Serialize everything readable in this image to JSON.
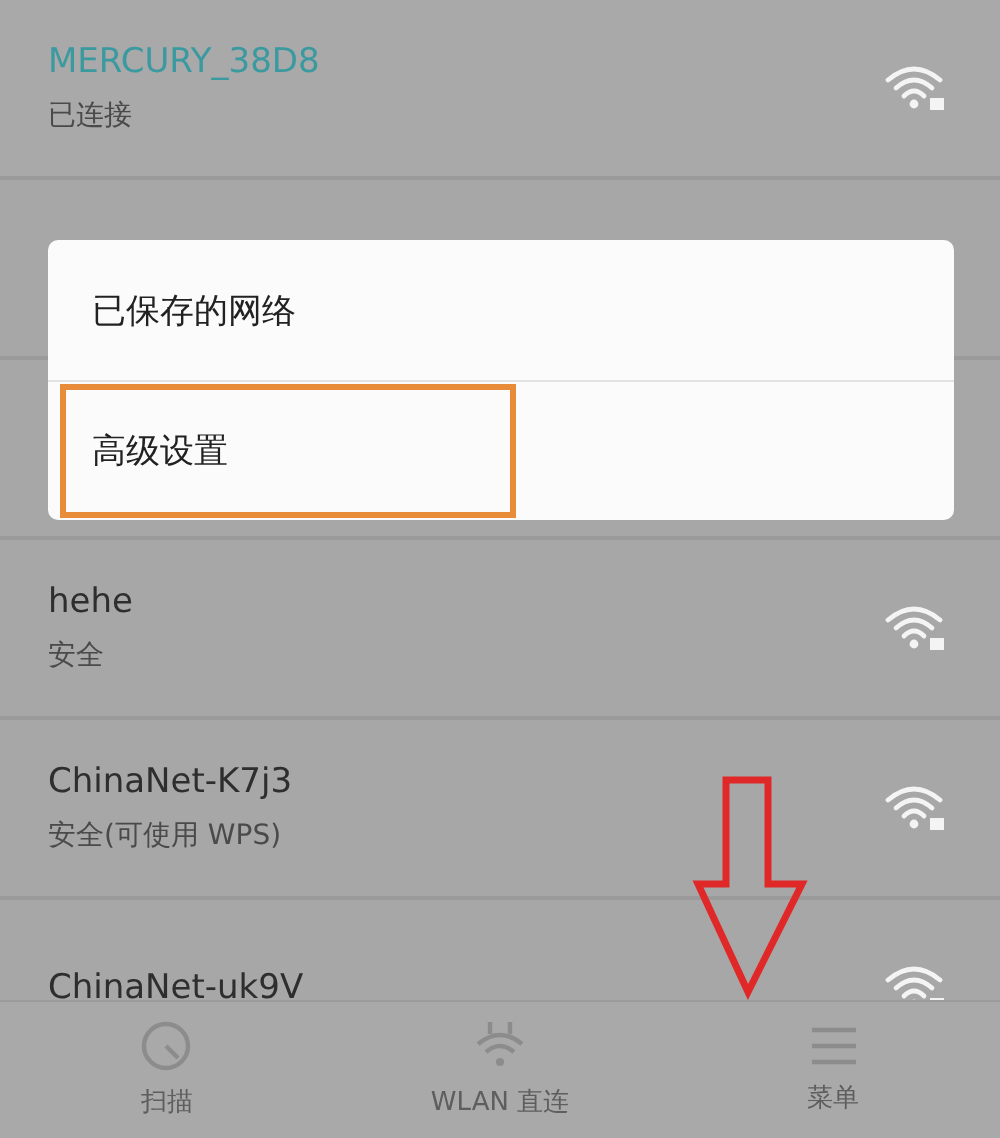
{
  "networks": [
    {
      "name": "MERCURY_38D8",
      "status": "已连接",
      "connected": true
    },
    {
      "name": "hehe",
      "status": "安全",
      "connected": false
    },
    {
      "name": "ChinaNet-K7j3",
      "status": "安全(可使用 WPS)",
      "connected": false
    },
    {
      "name": "ChinaNet-uk9V",
      "connected": false
    }
  ],
  "menu": [
    {
      "label": "已保存的网络",
      "highlighted": false
    },
    {
      "label": "高级设置",
      "highlighted": true
    }
  ],
  "bottom_bar": [
    {
      "kind": "scan",
      "label": "扫描"
    },
    {
      "kind": "direct",
      "label": "WLAN 直连"
    },
    {
      "kind": "menu",
      "label": "菜单"
    }
  ]
}
